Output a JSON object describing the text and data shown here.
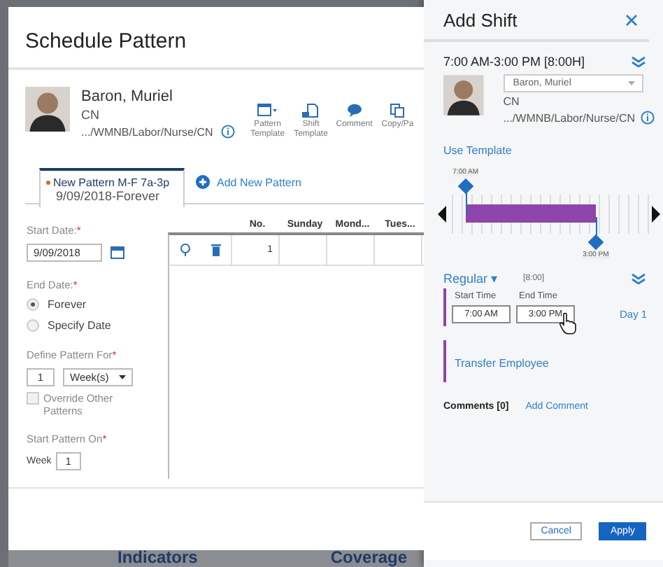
{
  "background": {
    "tabs": [
      {
        "label": "Indicators"
      },
      {
        "label": "Coverage"
      }
    ]
  },
  "schedule_pattern": {
    "title": "Schedule Pattern",
    "employee": {
      "name": "Baron, Muriel",
      "role": "CN",
      "path": ".../WMNB/Labor/Nurse/CN"
    },
    "toolbar": [
      {
        "kind": "template",
        "label": "Pattern Template"
      },
      {
        "kind": "shift",
        "label": "Shift Template"
      },
      {
        "kind": "comment",
        "label": "Comment"
      },
      {
        "kind": "copy",
        "label": "Copy/Pa"
      }
    ],
    "pattern_tab": {
      "title": "New Pattern M-F 7a-3p",
      "subtitle": "9/09/2018-Forever",
      "selected": true
    },
    "add_pattern": "Add New Pattern",
    "start_date": {
      "label": "Start Date:",
      "required": "*",
      "value": "9/09/2018"
    },
    "end_date": {
      "label": "End Date:",
      "required": "*",
      "options": [
        {
          "label": "Forever",
          "selected": true
        },
        {
          "label": "Specify Date",
          "selected": false
        }
      ]
    },
    "define_pattern": {
      "label": "Define Pattern For",
      "required": "*",
      "count": "1",
      "unit": "Week(s)"
    },
    "override": {
      "label": "Override Other Patterns",
      "checked": false
    },
    "start_pattern": {
      "label": "Start Pattern On",
      "required": "*",
      "prefix": "Week",
      "value": "1"
    },
    "table": {
      "columns": [
        "No.",
        "Sunday",
        "Mond...",
        "Tues..."
      ],
      "rows": [
        {
          "no": "1"
        }
      ]
    }
  },
  "add_shift": {
    "title": "Add Shift",
    "summary": "7:00 AM-3:00 PM [8:00H]",
    "employee": {
      "name": "Baron, Muriel",
      "role": "CN",
      "path": ".../WMNB/Labor/Nurse/CN"
    },
    "use_template": "Use Template",
    "timeline": {
      "start": {
        "label": "7:00 AM",
        "level": 0.07
      },
      "end": {
        "label": "3:00 PM",
        "level": 0.73
      }
    },
    "shift_type": "Regular",
    "shift_type_caret": "▾",
    "duration": "[8:00]",
    "start_time": {
      "label": "Start Time",
      "value": "7:00 AM"
    },
    "end_time": {
      "label": "End Time",
      "value": "3:00 PM"
    },
    "day": "Day 1",
    "transfer": "Transfer Employee",
    "comments": "Comments [0]",
    "add_comment": "Add Comment",
    "buttons": [
      {
        "label": "Cancel",
        "kind": "secondary"
      },
      {
        "label": "Apply",
        "kind": "primary"
      }
    ]
  }
}
